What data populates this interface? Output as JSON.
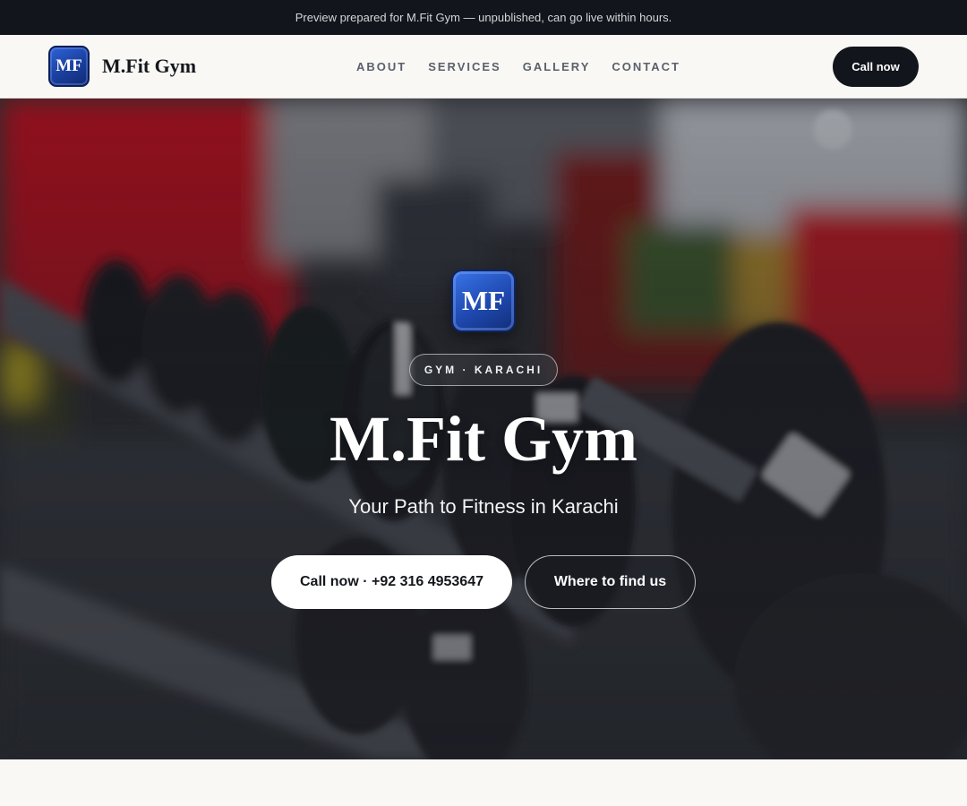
{
  "banner": {
    "text": "Preview prepared for M.Fit Gym — unpublished, can go live within hours."
  },
  "header": {
    "logo_text": "MF",
    "brand_name": "M.Fit Gym",
    "nav": [
      {
        "label": "ABOUT"
      },
      {
        "label": "SERVICES"
      },
      {
        "label": "GALLERY"
      },
      {
        "label": "CONTACT"
      }
    ],
    "cta_label": "Call now"
  },
  "hero": {
    "logo_text": "MF",
    "tag": "GYM · KARACHI",
    "title": "M.Fit Gym",
    "subtitle": "Your Path to Fitness in Karachi",
    "primary_button": "Call now · +92 316 4953647",
    "secondary_button": "Where to find us",
    "background_icon": "dumbbell-rack-photo"
  },
  "colors": {
    "dark": "#12151b",
    "page_bg": "#f9f8f5",
    "logo_blue": "#1f49b0",
    "accent_red": "#c0121c",
    "nav_text": "#5a606b"
  }
}
